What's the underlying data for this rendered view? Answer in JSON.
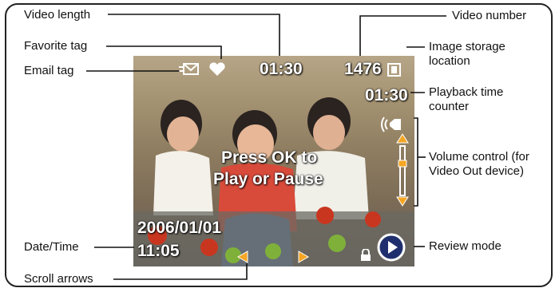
{
  "callouts": {
    "video_length": "Video length",
    "favorite_tag": "Favorite tag",
    "email_tag": "Email tag",
    "date_time": "Date/Time",
    "scroll_arrows": "Scroll arrows",
    "video_number": "Video number",
    "image_storage_location": "Image storage location",
    "playback_time_counter": "Playback time counter",
    "volume_control": "Volume control (for Video Out device)",
    "review_mode": "Review mode"
  },
  "screen": {
    "video_length": "01:30",
    "video_number": "1476",
    "playback_time": "01:30",
    "message_line1": "Press OK to",
    "message_line2": "Play or Pause",
    "date": "2006/01/01",
    "time": "11:05"
  },
  "icons": [
    "email-icon",
    "heart-icon",
    "memory-card-icon",
    "speaker-icon",
    "volume-slider-icon",
    "lock-icon",
    "review-play-icon",
    "left-arrow-icon",
    "right-arrow-icon"
  ],
  "colors": {
    "arrow_orange": "#f5a623",
    "osd_text": "#ffffff",
    "line": "#111111"
  }
}
